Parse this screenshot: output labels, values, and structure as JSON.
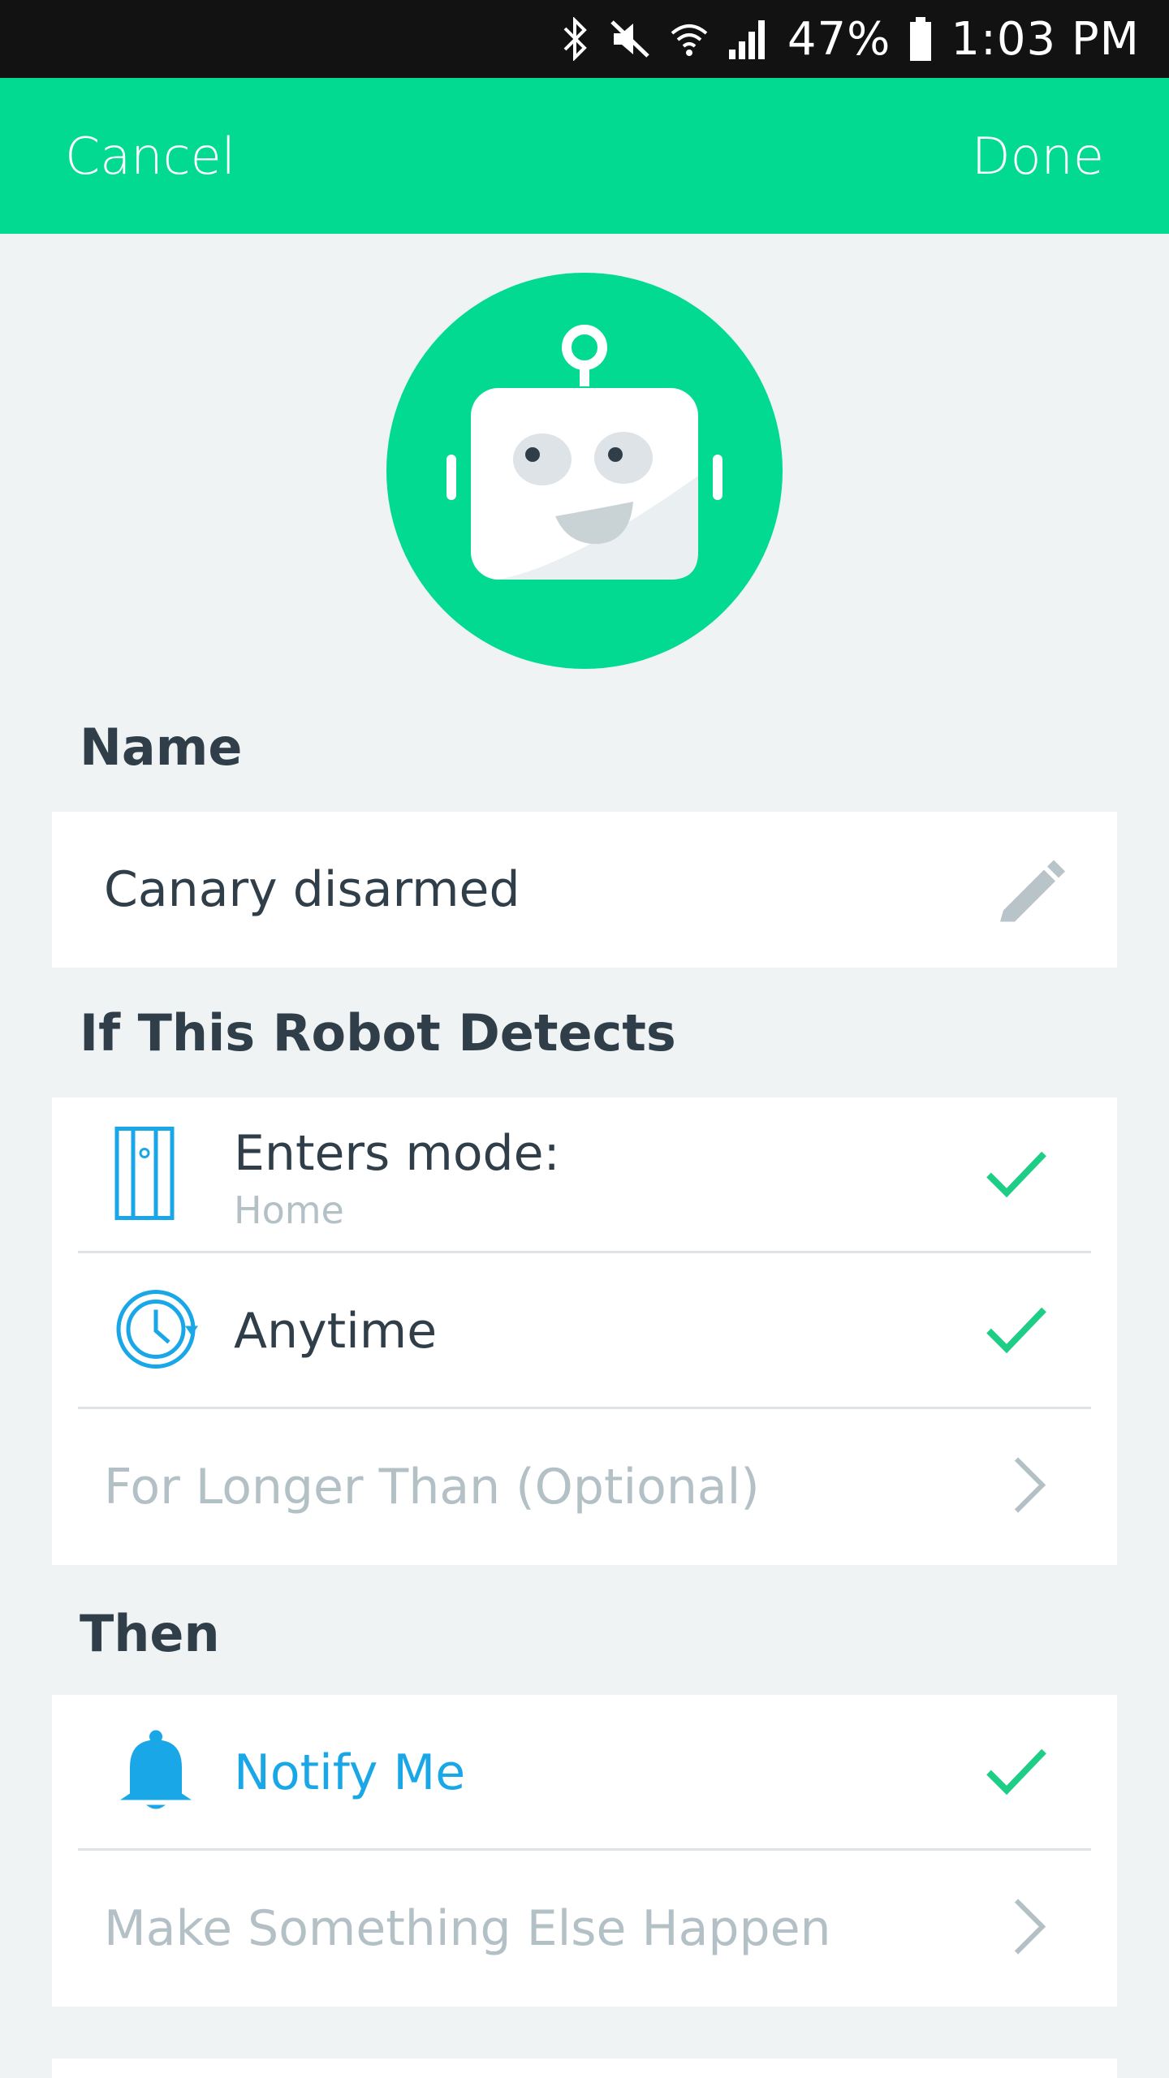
{
  "status_bar": {
    "battery_percent": "47%",
    "time": "1:03 PM"
  },
  "topbar": {
    "cancel_label": "Cancel",
    "done_label": "Done"
  },
  "sections": {
    "name_title": "Name",
    "name_value": "Canary disarmed",
    "if_title": "If This Robot Detects",
    "then_title": "Then"
  },
  "conditions": [
    {
      "label": "Enters mode:",
      "sublabel": "Home",
      "checked": true
    },
    {
      "label": "Anytime",
      "checked": true
    },
    {
      "label": "For Longer Than (Optional)"
    }
  ],
  "actions": [
    {
      "label": "Notify Me",
      "checked": true
    },
    {
      "label": "Make Something Else Happen"
    }
  ],
  "colors": {
    "brand_green": "#02d991",
    "accent_blue": "#1aa7e8",
    "check_green": "#1fce86"
  }
}
